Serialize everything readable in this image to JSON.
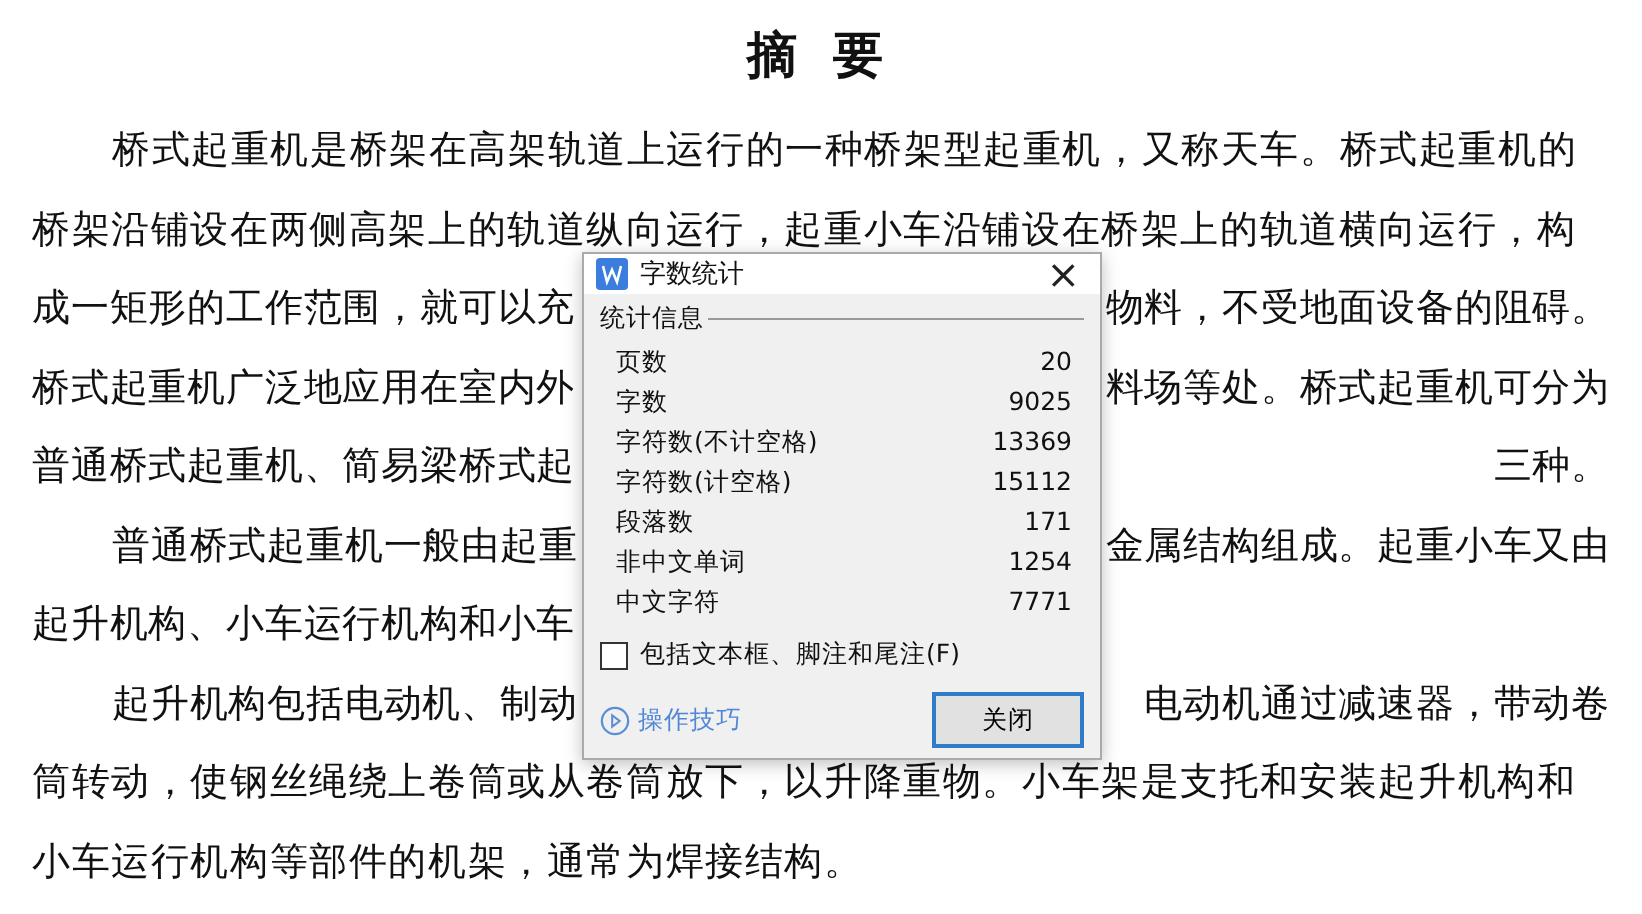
{
  "document": {
    "title": "摘 要",
    "lines": [
      {
        "indent": true,
        "left": "桥式起重机是桥架在高架轨道上运行的一种桥架型起重机，又称天车。桥式起重机的"
      },
      {
        "indent": false,
        "left": "桥架沿铺设在两侧高架上的轨道纵向运行，起重小车沿铺设在桥架上的轨道横向运行，构"
      },
      {
        "indent": false,
        "left": "成一矩形的工作范围，就可以充",
        "right": "物料，不受地面设备的阻碍。"
      },
      {
        "indent": false,
        "left": "桥式起重机广泛地应用在室内外",
        "right": "料场等处。桥式起重机可分为"
      },
      {
        "indent": false,
        "left": "普通桥式起重机、简易梁桥式起",
        "right": "三种。"
      },
      {
        "indent": true,
        "left": "普通桥式起重机一般由起重",
        "right": "金属结构组成。起重小车又由"
      },
      {
        "indent": false,
        "left": "起升机构、小车运行机构和小车"
      },
      {
        "indent": true,
        "left": "起升机构包括电动机、制动",
        "right": "电动机通过减速器，带动卷"
      },
      {
        "indent": false,
        "left": "筒转动，使钢丝绳绕上卷筒或从卷筒放下，以升降重物。小车架是支托和安装起升机构和"
      },
      {
        "indent": false,
        "left": "小车运行机构等部件的机架，通常为焊接结构。"
      }
    ]
  },
  "dialog": {
    "title": "字数统计",
    "close": "×",
    "group": "统计信息",
    "stats": [
      {
        "label": "页数",
        "value": "20"
      },
      {
        "label": "字数",
        "value": "9025"
      },
      {
        "label": "字符数(不计空格)",
        "value": "13369"
      },
      {
        "label": "字符数(计空格)",
        "value": "15112"
      },
      {
        "label": "段落数",
        "value": "171"
      },
      {
        "label": "非中文单词",
        "value": "1254"
      },
      {
        "label": "中文字符",
        "value": "7771"
      }
    ],
    "checkbox": {
      "label": "包括文本框、脚注和尾注(F)",
      "checked": false
    },
    "tips_link": "操作技巧",
    "button": "关闭"
  }
}
